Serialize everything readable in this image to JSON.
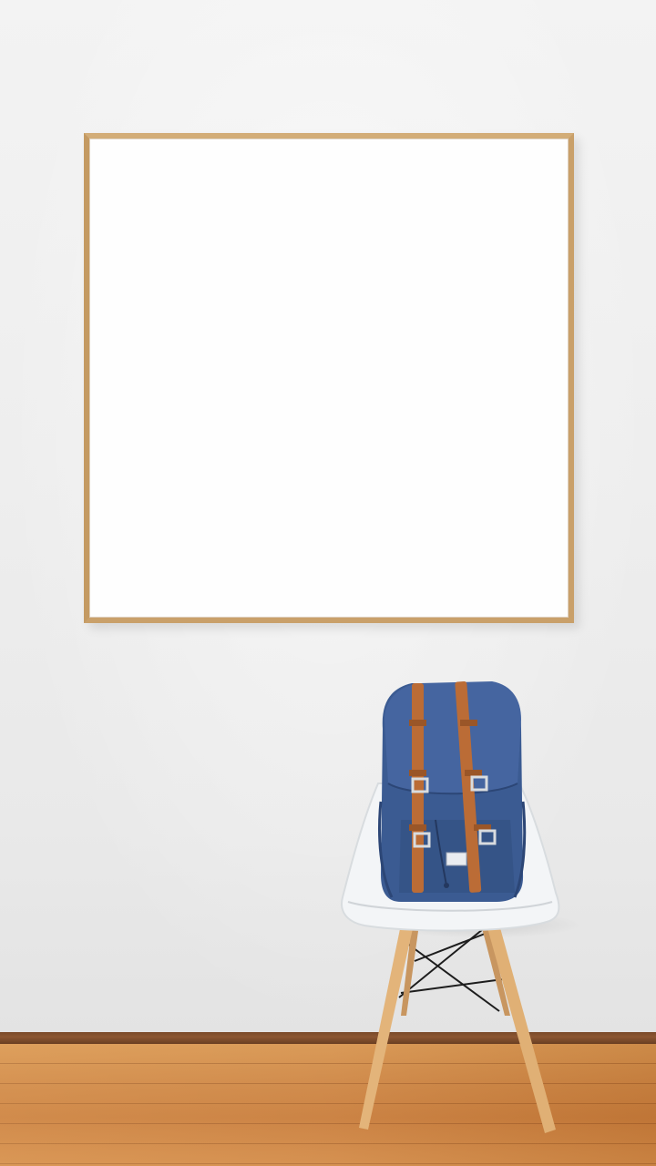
{
  "scene": {
    "description_items": [
      "wall",
      "picture-frame",
      "chair",
      "backpack",
      "floor"
    ],
    "colors": {
      "wall": "#eeeeee",
      "frame_wood": "#c9a06a",
      "backpack": "#3a5a91",
      "leather_strap": "#b86a35",
      "chair_seat": "#f2f4f6",
      "floor": "#cf8744"
    }
  }
}
